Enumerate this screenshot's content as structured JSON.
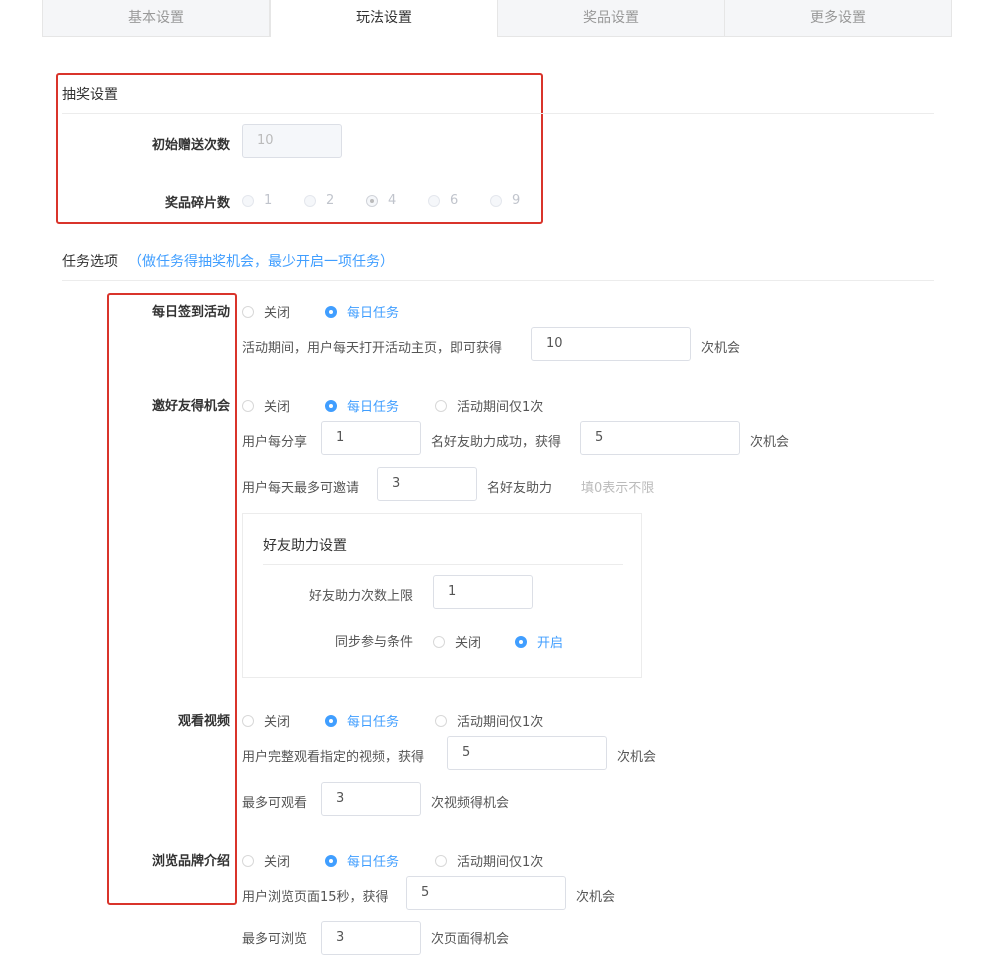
{
  "tabs": [
    {
      "label": "基本设置"
    },
    {
      "label": "玩法设置"
    },
    {
      "label": "奖品设置"
    },
    {
      "label": "更多设置"
    }
  ],
  "lottery": {
    "title": "抽奖设置",
    "initial_label": "初始赠送次数",
    "initial_value": "10",
    "fragments_label": "奖品碎片数",
    "fragment_options": [
      "1",
      "2",
      "4",
      "6",
      "9"
    ],
    "fragment_selected": "4"
  },
  "tasks": {
    "title": "任务选项",
    "note": "（做任务得抽奖机会，最少开启一项任务）",
    "opt_close": "关闭",
    "opt_daily": "每日任务",
    "opt_once": "活动期间仅1次",
    "checkin": {
      "label": "每日签到活动",
      "desc": "活动期间，用户每天打开活动主页，即可获得",
      "value": "10",
      "suffix": "次机会"
    },
    "invite": {
      "label": "邀好友得机会",
      "share_prefix": "用户每分享",
      "share_value": "1",
      "share_mid": "名好友助力成功，获得",
      "share_reward": "5",
      "share_suffix": "次机会",
      "max_prefix": "用户每天最多可邀请",
      "max_value": "3",
      "max_suffix": "名好友助力",
      "max_hint": "填0表示不限",
      "panel_title": "好友助力设置",
      "limit_label": "好友助力次数上限",
      "limit_value": "1",
      "sync_label": "同步参与条件",
      "sync_off": "关闭",
      "sync_on": "开启"
    },
    "video": {
      "label": "观看视频",
      "desc": "用户完整观看指定的视频，获得",
      "value": "5",
      "suffix": "次机会",
      "max_prefix": "最多可观看",
      "max_value": "3",
      "max_suffix": "次视频得机会"
    },
    "brand": {
      "label": "浏览品牌介绍",
      "desc": "用户浏览页面15秒，获得",
      "value": "5",
      "suffix": "次机会",
      "max_prefix": "最多可浏览",
      "max_value": "3",
      "max_suffix": "次页面得机会"
    }
  },
  "colors": {
    "accent": "#409eff",
    "highlight": "#d9342b"
  }
}
